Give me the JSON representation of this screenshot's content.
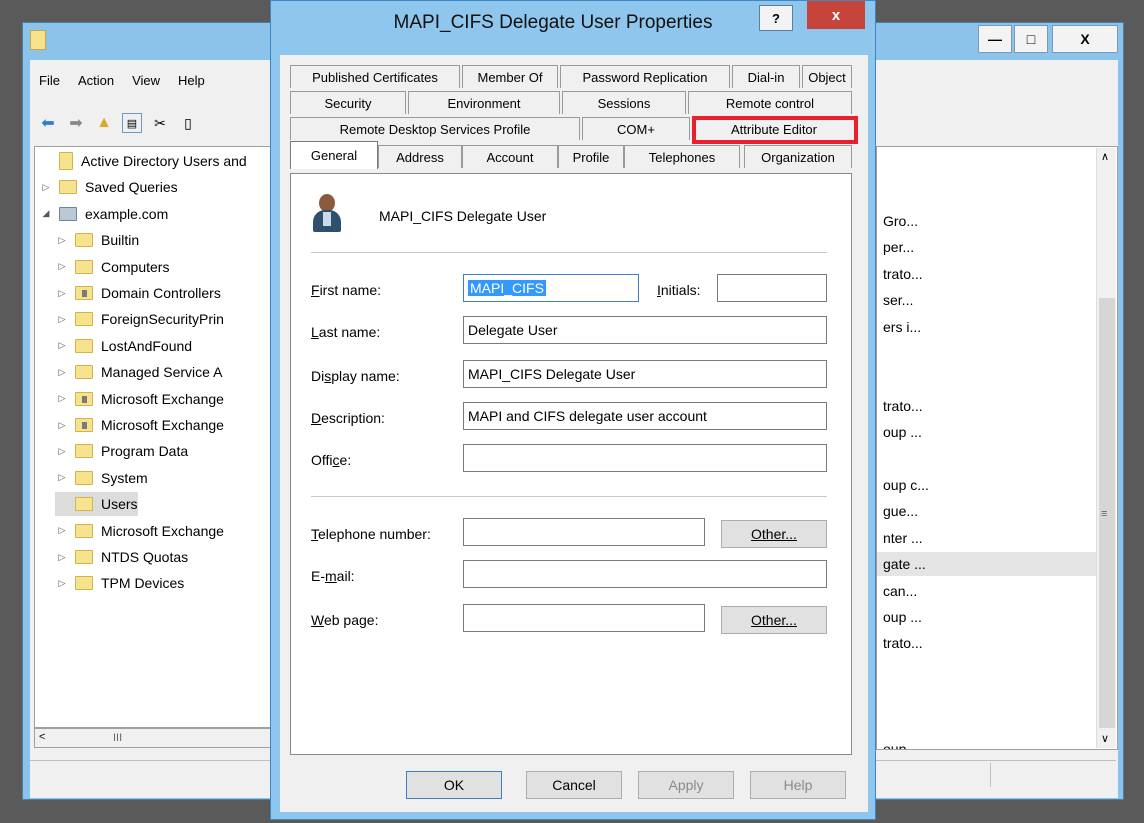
{
  "background_window": {
    "minimize_label": "—",
    "maximize_label": "□",
    "close_label": "X",
    "menu": [
      "File",
      "Action",
      "View",
      "Help"
    ],
    "tree": [
      {
        "label": "Active Directory Users and",
        "arrow": "",
        "icon": "book"
      },
      {
        "label": "Saved Queries",
        "arrow": "▷",
        "icon": "folder"
      },
      {
        "label": "example.com",
        "arrow": "◢",
        "icon": "domain"
      },
      {
        "label": "Builtin",
        "arrow": "▷",
        "icon": "folder"
      },
      {
        "label": "Computers",
        "arrow": "▷",
        "icon": "folder"
      },
      {
        "label": "Domain Controllers",
        "arrow": "▷",
        "icon": "ou"
      },
      {
        "label": "ForeignSecurityPrin",
        "arrow": "▷",
        "icon": "folder"
      },
      {
        "label": "LostAndFound",
        "arrow": "▷",
        "icon": "folder"
      },
      {
        "label": "Managed Service A",
        "arrow": "▷",
        "icon": "folder"
      },
      {
        "label": "Microsoft Exchange",
        "arrow": "▷",
        "icon": "ou"
      },
      {
        "label": "Microsoft Exchange",
        "arrow": "▷",
        "icon": "ou"
      },
      {
        "label": "Program Data",
        "arrow": "▷",
        "icon": "folder"
      },
      {
        "label": "System",
        "arrow": "▷",
        "icon": "folder"
      },
      {
        "label": "Users",
        "arrow": "",
        "icon": "folder"
      },
      {
        "label": "Microsoft Exchange",
        "arrow": "▷",
        "icon": "folder"
      },
      {
        "label": "NTDS Quotas",
        "arrow": "▷",
        "icon": "folder"
      },
      {
        "label": "TPM Devices",
        "arrow": "▷",
        "icon": "folder"
      }
    ],
    "hscroll_thumb": "III",
    "list": [
      {
        "text": "Gro...",
        "row": 2
      },
      {
        "text": "per...",
        "row": 3
      },
      {
        "text": "trato...",
        "row": 4
      },
      {
        "text": "ser...",
        "row": 5
      },
      {
        "text": "ers i...",
        "row": 6
      },
      {
        "text": "trato...",
        "row": 9
      },
      {
        "text": "oup ...",
        "row": 10
      },
      {
        "text": "oup c...",
        "row": 12
      },
      {
        "text": "gue...",
        "row": 13
      },
      {
        "text": "nter ...",
        "row": 14
      },
      {
        "text": "gate ...",
        "row": 15,
        "selected": true
      },
      {
        "text": "can...",
        "row": 16
      },
      {
        "text": "oup ...",
        "row": 17
      },
      {
        "text": "trato...",
        "row": 18
      },
      {
        "text": "oup ...",
        "row": 22
      }
    ]
  },
  "dialog": {
    "title": "MAPI_CIFS Delegate User Properties",
    "help_label": "?",
    "close_label": "x",
    "tabs_row1": [
      "Published Certificates",
      "Member Of",
      "Password Replication",
      "Dial-in",
      "Object"
    ],
    "tabs_row2": [
      "Security",
      "Environment",
      "Sessions",
      "Remote control"
    ],
    "tabs_row3": [
      "Remote Desktop Services Profile",
      "COM+",
      "Attribute Editor"
    ],
    "tabs_row4": [
      "General",
      "Address",
      "Account",
      "Profile",
      "Telephones",
      "Organization"
    ],
    "user_display": "MAPI_CIFS Delegate User",
    "fields": {
      "first_name_label": "First name:",
      "first_name_value": "MAPI_CIFS",
      "initials_label": "Initials:",
      "initials_value": "",
      "last_name_label": "Last name:",
      "last_name_value": "Delegate User",
      "display_name_label": "Display name:",
      "display_name_value": "MAPI_CIFS Delegate User",
      "description_label": "Description:",
      "description_value": "MAPI and CIFS delegate user account",
      "office_label": "Office:",
      "office_value": "",
      "telephone_label": "Telephone number:",
      "telephone_value": "",
      "other_label": "Other...",
      "email_label": "E-mail:",
      "email_value": "",
      "webpage_label": "Web page:",
      "webpage_value": ""
    },
    "buttons": {
      "ok": "OK",
      "cancel": "Cancel",
      "apply": "Apply",
      "help": "Help"
    },
    "highlight_color": "#e8202e"
  }
}
